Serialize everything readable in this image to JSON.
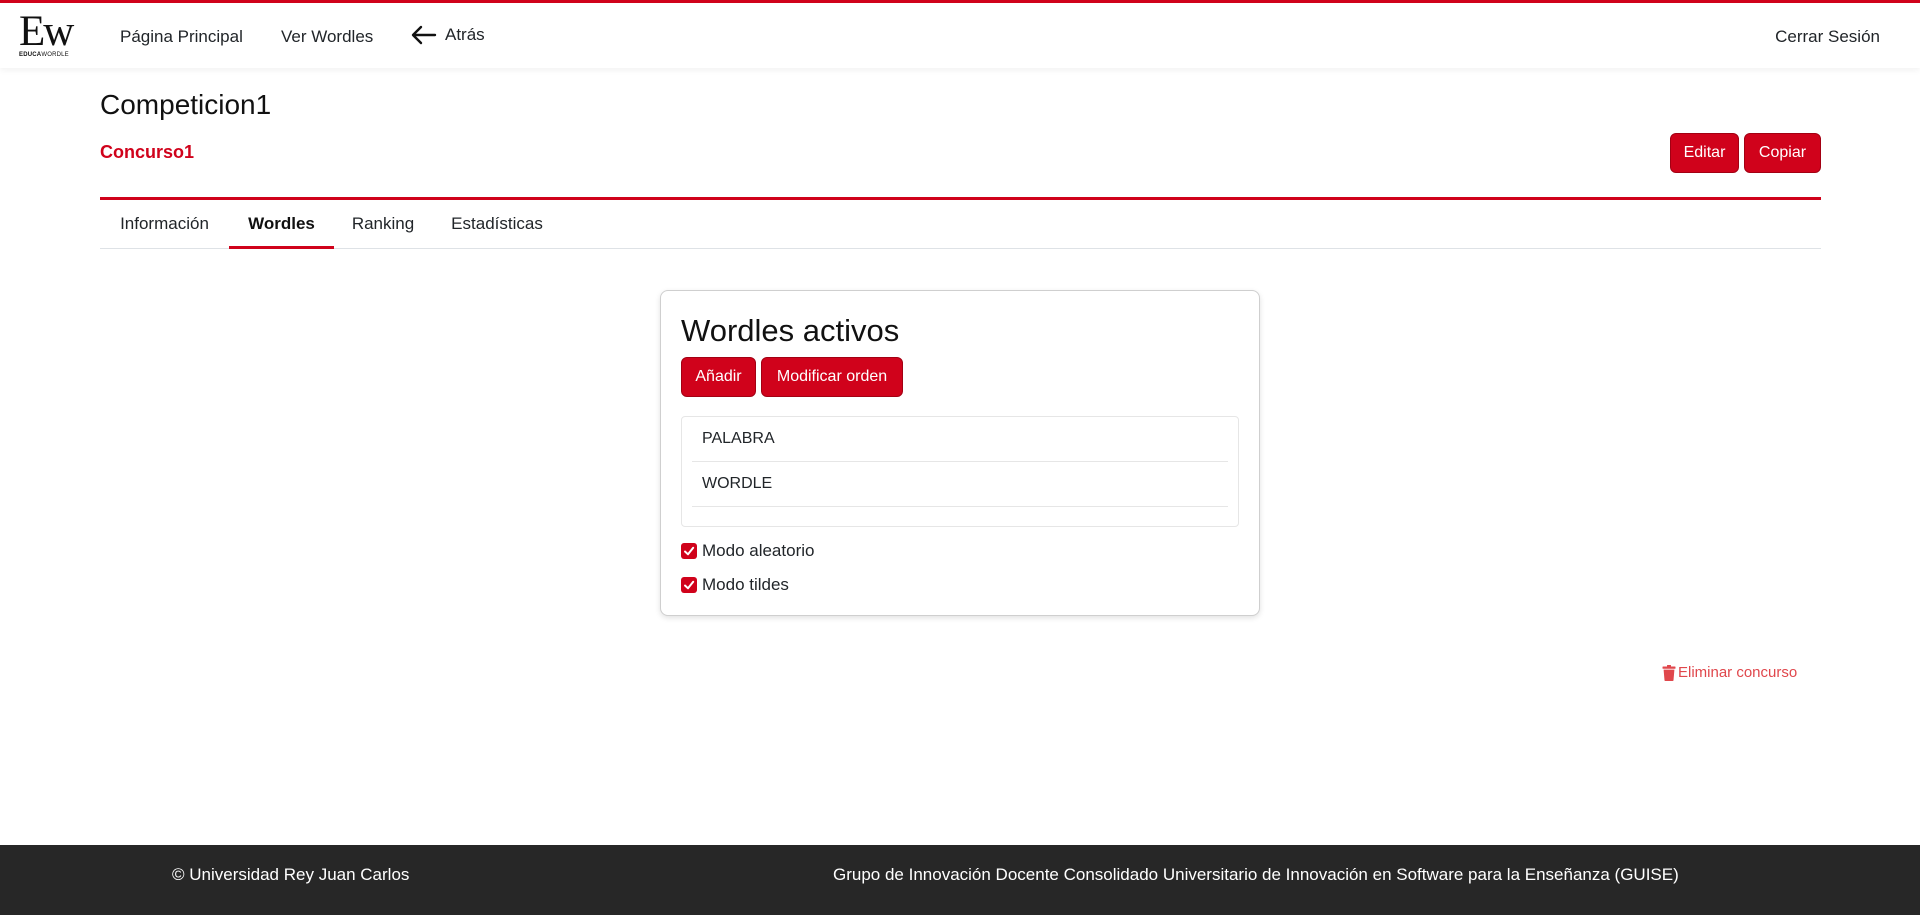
{
  "brand": {
    "logo_letters": "Ew",
    "logo_sub_bold": "EDUCA",
    "logo_sub": "WORDLE"
  },
  "nav": {
    "home": "Página Principal",
    "wordles": "Ver Wordles",
    "back": "Atrás",
    "logout": "Cerrar Sesión"
  },
  "header": {
    "title": "Competicion1",
    "contest": "Concurso1",
    "edit_label": "Editar",
    "copy_label": "Copiar"
  },
  "tabs": [
    {
      "label": "Información",
      "active": false
    },
    {
      "label": "Wordles",
      "active": true
    },
    {
      "label": "Ranking",
      "active": false
    },
    {
      "label": "Estadísticas",
      "active": false
    }
  ],
  "card": {
    "title": "Wordles activos",
    "add_label": "Añadir",
    "order_label": "Modificar orden",
    "words": [
      "PALABRA",
      "WORDLE"
    ],
    "options": [
      {
        "label": "Modo aleatorio",
        "checked": true
      },
      {
        "label": "Modo tildes",
        "checked": true
      }
    ]
  },
  "delete_label": "Eliminar concurso",
  "footer": {
    "left": "© Universidad Rey Juan Carlos",
    "right": "Grupo de Innovación Docente Consolidado Universitario de Innovación en Software para la Enseñanza (GUISE)"
  },
  "colors": {
    "accent": "#d0021b",
    "danger_link": "#e0474c",
    "footer_bg": "#272727"
  },
  "icons": {
    "back": "arrow-left-icon",
    "delete": "trash-icon",
    "check": "checkmark-icon"
  }
}
